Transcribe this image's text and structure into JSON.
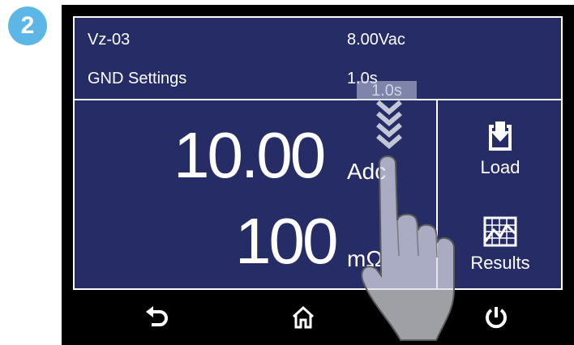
{
  "step": {
    "number": "2",
    "color": "#5cb6e6"
  },
  "header": {
    "file_name": "Vz-03",
    "voltage": "8.00Vac",
    "settings_label": "GND Settings",
    "dwell_time": "1.0s",
    "dwell_ghost": "1.0s"
  },
  "readings": {
    "current_value": "10.00",
    "current_unit": "Adc",
    "resistance_value": "100",
    "resistance_unit": "mΩ"
  },
  "side_buttons": {
    "load_label": "Load",
    "results_label": "Results"
  },
  "nav": {
    "back_icon": "back-arrow-icon",
    "home_icon": "home-icon",
    "power_icon": "power-icon"
  },
  "colors": {
    "screen_bg": "#252c66",
    "badge": "#5cb6e6",
    "device": "#000000"
  },
  "gesture": {
    "type": "swipe-down",
    "icon": "hand-pointer-icon"
  }
}
